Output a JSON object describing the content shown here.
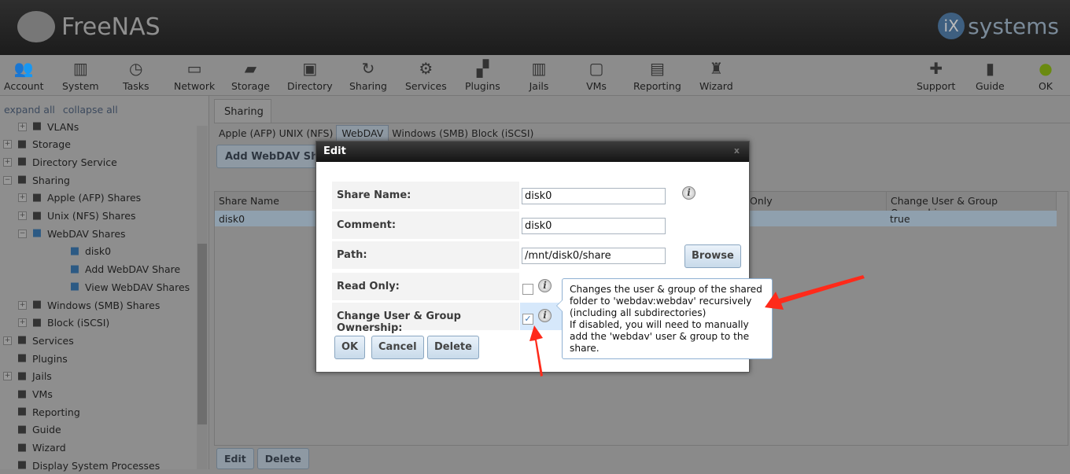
{
  "header": {
    "logo": "FreeNAS",
    "vendor_logo": "iXsystems"
  },
  "nav": [
    {
      "label": "Account",
      "icon": "account-icon"
    },
    {
      "label": "System",
      "icon": "system-icon"
    },
    {
      "label": "Tasks",
      "icon": "tasks-icon"
    },
    {
      "label": "Network",
      "icon": "network-icon"
    },
    {
      "label": "Storage",
      "icon": "storage-icon"
    },
    {
      "label": "Directory",
      "icon": "directory-icon"
    },
    {
      "label": "Sharing",
      "icon": "sharing-icon"
    },
    {
      "label": "Services",
      "icon": "services-icon"
    },
    {
      "label": "Plugins",
      "icon": "plugins-icon"
    },
    {
      "label": "Jails",
      "icon": "jails-icon"
    },
    {
      "label": "VMs",
      "icon": "vms-icon"
    },
    {
      "label": "Reporting",
      "icon": "reporting-icon"
    },
    {
      "label": "Wizard",
      "icon": "wizard-icon"
    },
    {
      "label": "Support",
      "icon": "support-icon"
    },
    {
      "label": "Guide",
      "icon": "guide-icon"
    },
    {
      "label": "OK",
      "icon": "status-ok-icon"
    }
  ],
  "sidebar": {
    "expand_all": "expand all",
    "collapse_all": "collapse all",
    "items": [
      "VLANs",
      "Storage",
      "Directory Service",
      "Sharing",
      "Apple (AFP) Shares",
      "Unix (NFS) Shares",
      "WebDAV Shares",
      "disk0",
      "Add WebDAV Share",
      "View WebDAV Shares",
      "Windows (SMB) Shares",
      "Block (iSCSI)",
      "Services",
      "Plugins",
      "Jails",
      "VMs",
      "Reporting",
      "Guide",
      "Wizard",
      "Display System Processes"
    ]
  },
  "main": {
    "tab": "Sharing",
    "subtabs": [
      "Apple (AFP)",
      "UNIX (NFS)",
      "WebDAV",
      "Windows (SMB)",
      "Block (iSCSI)"
    ],
    "active_subtab": "WebDAV",
    "add_button": "Add WebDAV Share",
    "columns": [
      "Share Name",
      "Only",
      "Change User & Group Ownership"
    ],
    "rows": [
      {
        "name": "disk0",
        "ownership": "true"
      }
    ],
    "edit_button": "Edit",
    "delete_button": "Delete"
  },
  "dialog": {
    "title": "Edit",
    "close": "x",
    "share_name_label": "Share Name:",
    "share_name": "disk0",
    "comment_label": "Comment:",
    "comment": "disk0",
    "path_label": "Path:",
    "path": "/mnt/disk0/share",
    "browse": "Browse",
    "read_only_label": "Read Only:",
    "read_only": false,
    "ownership_label": "Change User & Group Ownership:",
    "ownership": true,
    "ok": "OK",
    "cancel": "Cancel",
    "delete": "Delete",
    "tooltip": [
      "Changes the user & group of the shared",
      "folder to 'webdav:webdav' recursively",
      "(including all subdirectories)",
      "If disabled, you will need to manually",
      "add the 'webdav' user & group to the",
      "share."
    ]
  },
  "colors": {
    "annotation_arrow": "#ff2a1a",
    "highlight": "#d6e8fb"
  }
}
